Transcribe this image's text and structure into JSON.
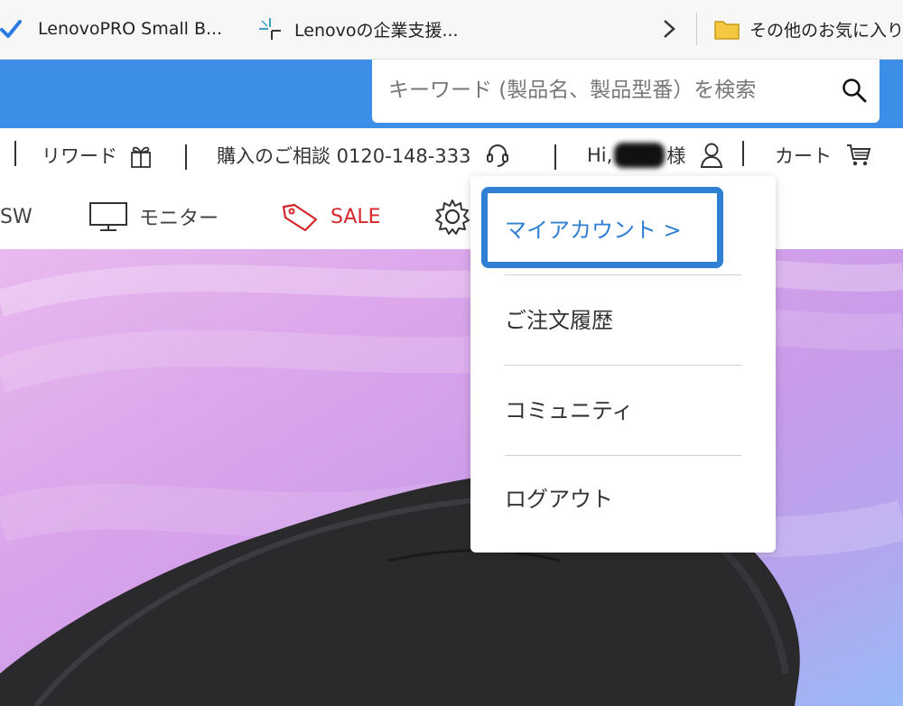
{
  "bookmarks": {
    "items": [
      {
        "label": "LenovoPRO Small B...",
        "icon": "checkmark-icon"
      },
      {
        "label": "Lenovoの企業支援...",
        "icon": "lenovo-sparkle-icon"
      }
    ],
    "folder_label": "その他のお気に入り"
  },
  "search": {
    "placeholder": "キーワード (製品名、製品型番）を検索",
    "icon": "search-icon"
  },
  "utility": {
    "reward_label": "リワード",
    "consult_label": "購入のご相談 0120-148-333",
    "greeting_label": "Hi, ",
    "greeting_suffix": "様",
    "cart_label": "カート"
  },
  "nav": {
    "sw_label": "SW",
    "monitor_label": "モニター",
    "sale_label": "SALE"
  },
  "dropdown": {
    "my_account": "マイアカウント >",
    "orders": "ご注文履歴",
    "community": "コミュニティ",
    "logout": "ログアウト"
  },
  "colors": {
    "header_blue": "#3d8ee6",
    "highlight_blue": "#2f7fd3",
    "link_blue": "#2f7fd3",
    "sale_red": "#d6262b",
    "folder_yellow": "#f5c842"
  }
}
